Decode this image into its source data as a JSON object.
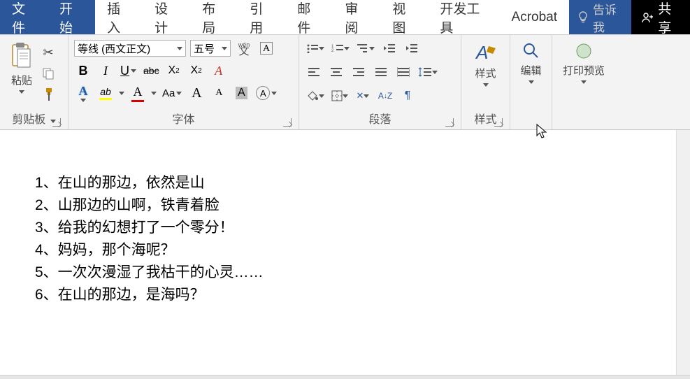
{
  "tabs": {
    "file": "文件",
    "home": "开始",
    "insert": "插入",
    "design": "设计",
    "layout": "布局",
    "references": "引用",
    "mailings": "邮件",
    "review": "审阅",
    "view": "视图",
    "devtools": "开发工具",
    "acrobat": "Acrobat",
    "tellme": "告诉我",
    "share": "共享"
  },
  "ribbon": {
    "clipboard": {
      "label": "剪贴板",
      "paste": "粘贴"
    },
    "font": {
      "label": "字体",
      "family": "等线 (西文正文)",
      "size": "五号",
      "phonetic": "wén",
      "bold": "B",
      "italic": "I",
      "underline": "U",
      "strike": "abc",
      "sub": "X",
      "sup": "X",
      "clearfmt": "A",
      "txteffect": "A",
      "highlight": "A",
      "fontcolor": "A",
      "cspace": "Aa",
      "bigA": "A",
      "smallA": "A",
      "shade": "A",
      "border": "A"
    },
    "paragraph": {
      "label": "段落"
    },
    "styles": {
      "label": "样式",
      "btn": "样式"
    },
    "editing": {
      "btn": "编辑"
    },
    "printpreview": {
      "btn": "打印预览"
    }
  },
  "document": {
    "lines": [
      "1、在山的那边，依然是山",
      "2、山那边的山啊，铁青着脸",
      "3、给我的幻想打了一个零分！",
      "4、妈妈，那个海呢？",
      "5、一次次漫湿了我枯干的心灵……",
      "6、在山的那边，是海吗？"
    ]
  }
}
